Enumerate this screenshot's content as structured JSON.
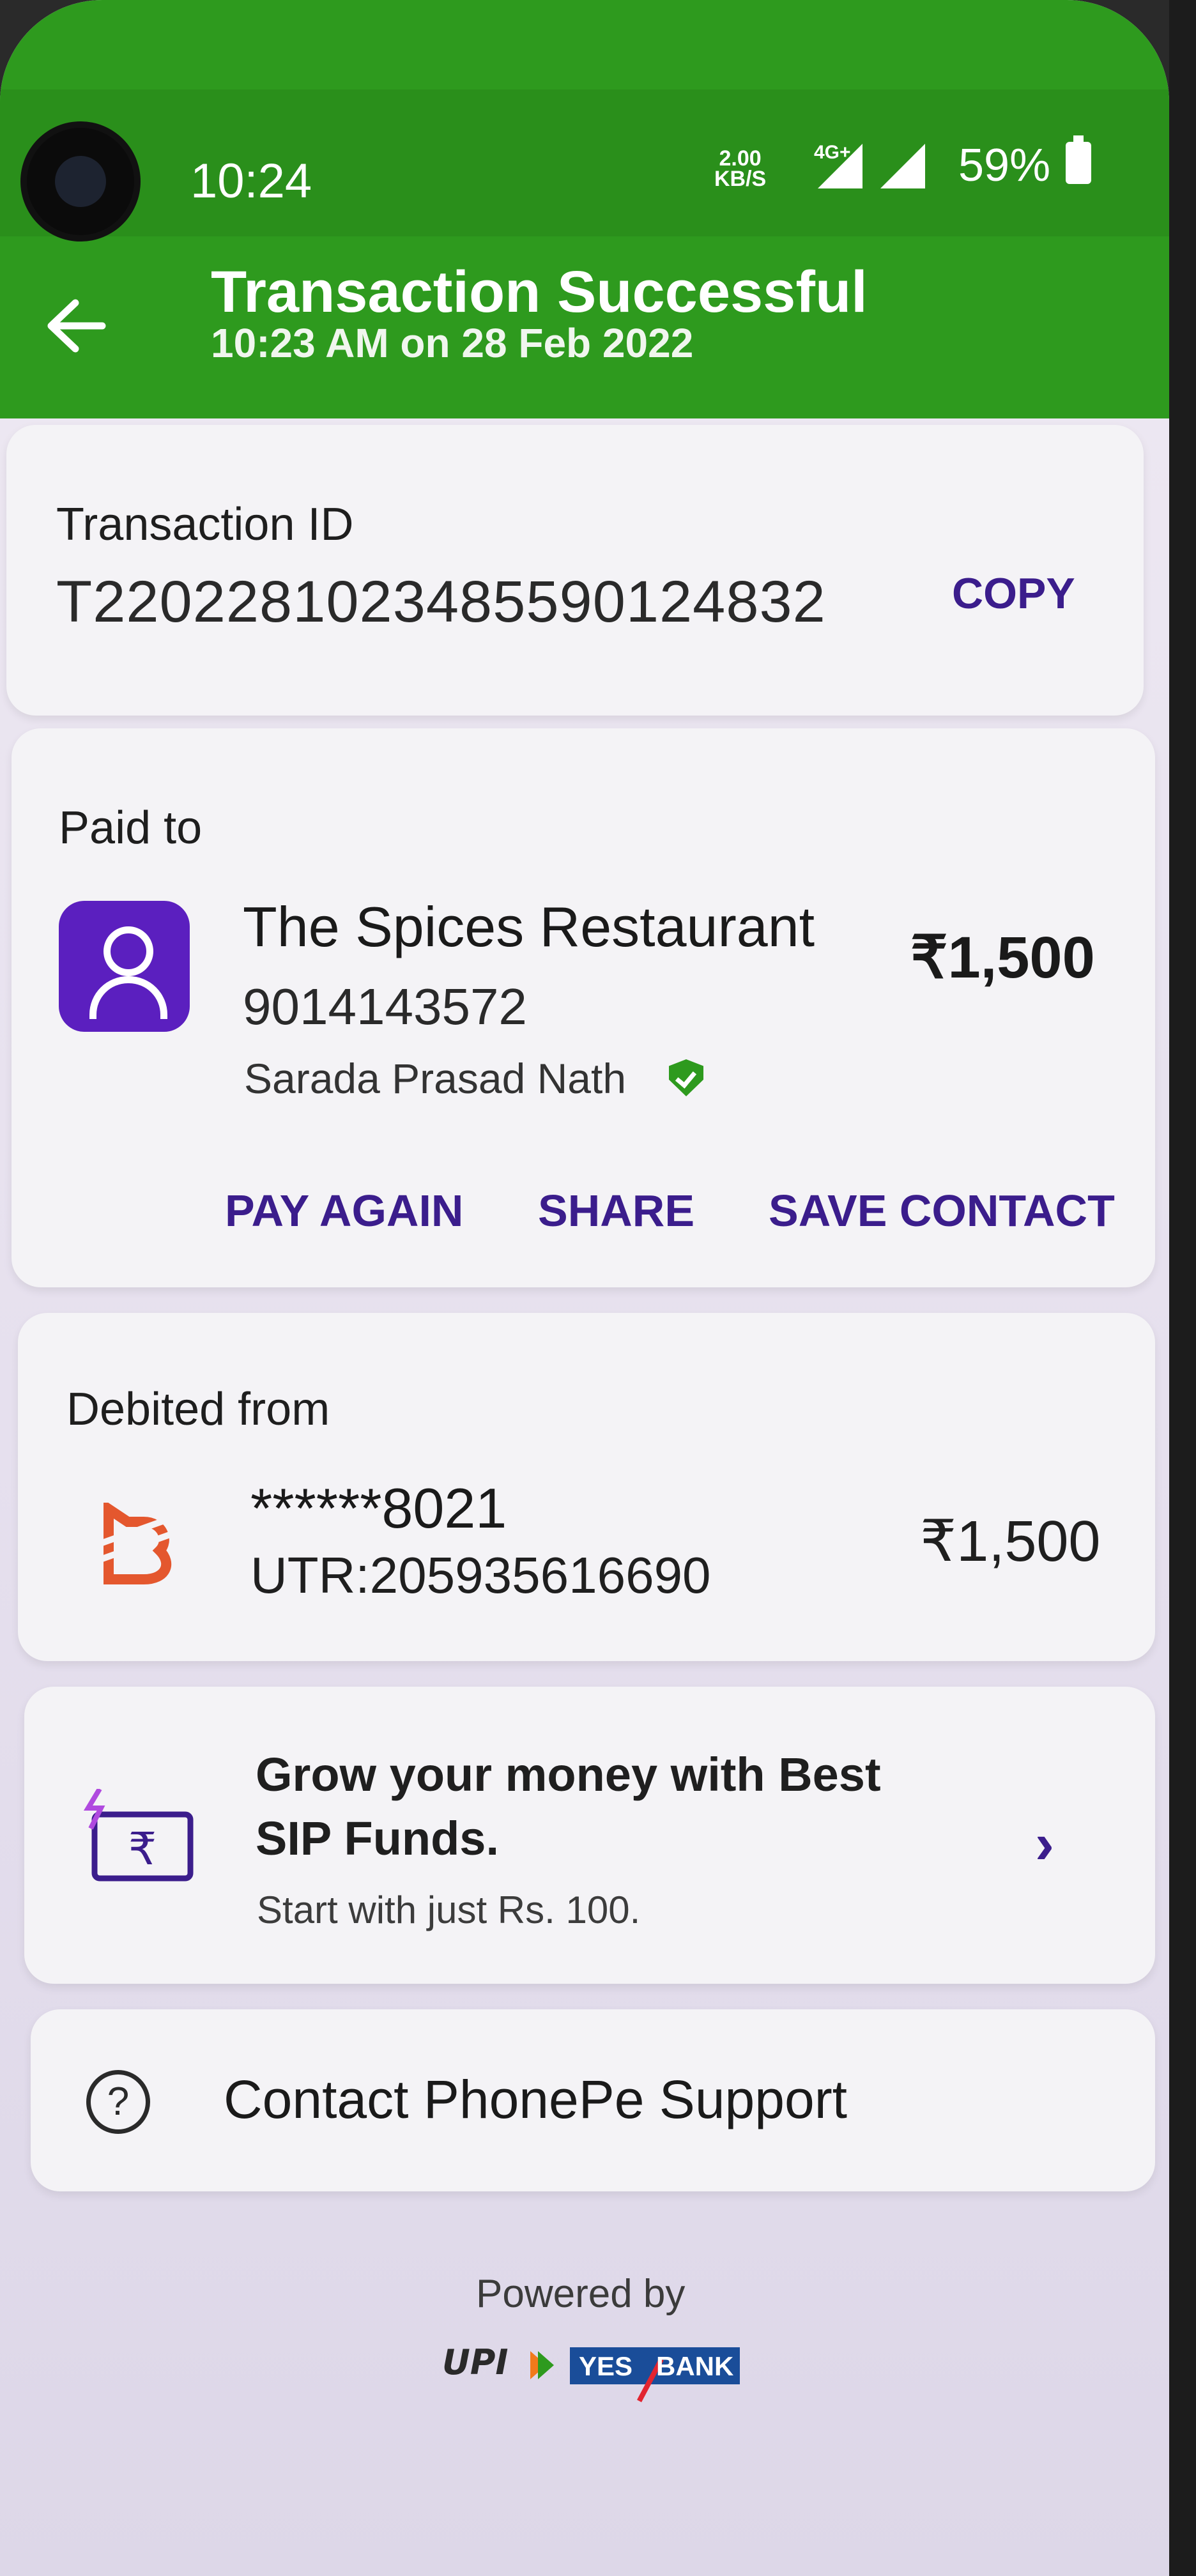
{
  "status_bar": {
    "time": "10:24",
    "net_speed_value": "2.00",
    "net_speed_unit": "KB/S",
    "network_type": "4G+",
    "battery": "59%"
  },
  "header": {
    "title": "Transaction Successful",
    "subtitle": "10:23 AM on 28 Feb 2022",
    "color": "#2e9a1e"
  },
  "transaction": {
    "label": "Transaction ID",
    "id": "T2202281023485590124832",
    "copy_label": "COPY"
  },
  "paid_to": {
    "label": "Paid to",
    "name": "The Spices Restaurant",
    "phone": "9014143572",
    "owner": "Sarada Prasad  Nath",
    "amount": "₹1,500",
    "actions": {
      "pay_again": "PAY AGAIN",
      "share": "SHARE",
      "save_contact": "SAVE CONTACT"
    }
  },
  "debited_from": {
    "label": "Debited from",
    "account": "******8021",
    "utr": "UTR:205935616690",
    "amount": "₹1,500",
    "bank_logo_icon": "bank-of-baroda-logo"
  },
  "sip_promo": {
    "title_line1": "Grow your money with Best",
    "title_line2": "SIP Funds.",
    "subtitle": "Start with just Rs. 100.",
    "icon": "rupee-card-icon"
  },
  "support": {
    "label": "Contact PhonePe Support",
    "icon": "help-circle-icon"
  },
  "footer": {
    "powered_by": "Powered by",
    "upi_logo_text": "UPI",
    "yes_bank_word": "YES",
    "bank_word": "BANK"
  },
  "colors": {
    "accent": "#3b1d8c",
    "avatar": "#5b1fbf",
    "verified": "#2e9a1e"
  }
}
